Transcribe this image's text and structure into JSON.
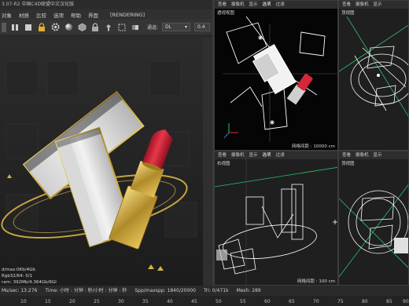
{
  "app": {
    "title": "3.07-R2 中国C4D联盟中文汉化版",
    "menus": [
      "对象",
      "材质",
      "比较",
      "选项",
      "帮助",
      "界面"
    ],
    "mode": "[RENDERING]"
  },
  "toolbar": {
    "channel_label": "通道:",
    "channel_value": "DL",
    "numeric_value": "0.4",
    "icons": [
      "pause-icon",
      "stop-icon",
      "lock-icon",
      "settings-gear-icon",
      "sphere-icon",
      "cube-icon",
      "lock-icon",
      "pin-icon",
      "region-icon",
      "compare-icon"
    ]
  },
  "render_stats": [
    "d/max:0Kb/4Gb",
    "Rgb32/64: 0/1",
    "ram: 392Mb/4.364Gb/6Gl"
  ],
  "status": {
    "ms_sec": "Ms/sec: 13.276",
    "time": "Time: 小时 : 分钟 : 秒/小时 : 分钟 : 秒",
    "spp": "Spp/maxspp: 1840/20000",
    "tri": "Tri: 0/471k",
    "mesh": "Mesh: 289"
  },
  "timeline": {
    "ticks": [
      "10",
      "15",
      "20",
      "25",
      "30",
      "35",
      "40",
      "45",
      "50",
      "55",
      "60",
      "65",
      "70",
      "75",
      "80",
      "85",
      "90"
    ]
  },
  "viewports": {
    "tl": {
      "menu": [
        "查看",
        "摄像机",
        "显示",
        "选项",
        "过滤"
      ],
      "active_menu": "选项",
      "name": "透视视图",
      "footer": "网格间距 : 10000 cm"
    },
    "tr": {
      "menu": [
        "查看",
        "摄像机",
        "显示"
      ],
      "name": "顶视图",
      "footer": ""
    },
    "bl": {
      "menu": [
        "查看",
        "摄像机",
        "显示",
        "选项",
        "过滤"
      ],
      "active_menu": "选项",
      "name": "右视图",
      "footer": "网格间距 : 100 cm"
    },
    "br": {
      "menu": [
        "查看",
        "摄像机",
        "显示"
      ],
      "name": "顶视图",
      "footer": ""
    }
  },
  "colors": {
    "lipstick": "#d6263a",
    "gold": "#d4b24a",
    "box_white": "#e9e9e9",
    "wireframe": "#ffffff",
    "axis_green": "#2bbf6f"
  }
}
